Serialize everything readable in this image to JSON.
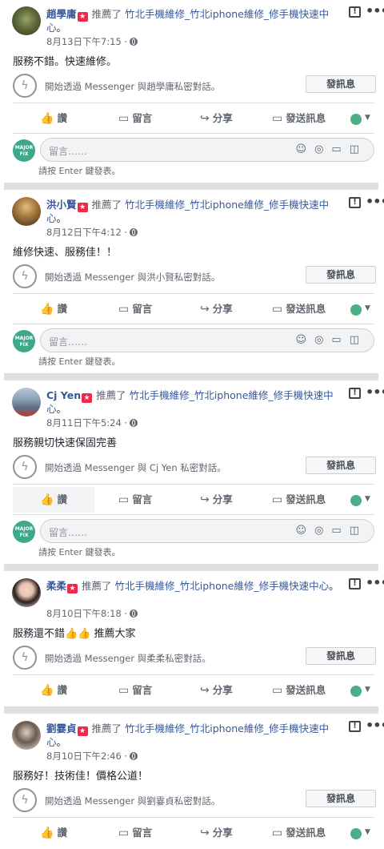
{
  "common": {
    "recommended": "推薦了",
    "page_name": "竹北手機維修_竹北iphone維修_修手機快速中心",
    "page_suffix": "。",
    "messenger_btn": "發訊息",
    "like": "讚",
    "comment": "留言",
    "share": "分享",
    "send": "發送訊息",
    "comment_placeholder": "留言……",
    "enter_hint": "請按 Enter 鍵發表。",
    "commenter_avatar": "MAJOR FIX",
    "flag_icon": "flag-icon",
    "more_icon": "more-icon"
  },
  "posts": [
    {
      "name": "趙學庸",
      "time": "8月13日下午7:15 ·",
      "body": "服務不錯。快速維修。",
      "messenger": "開始透過 Messenger 與趙學庸私密對話。"
    },
    {
      "name": "洪小賢",
      "time": "8月12日下午4:12 ·",
      "body": "維修快速、服務佳！！",
      "messenger": "開始透過 Messenger 與洪小賢私密對話。"
    },
    {
      "name": "Cj Yen",
      "time": "8月11日下午5:24 ·",
      "body": "服務親切快速保固完善",
      "messenger": "開始透過 Messenger 與 Cj Yen 私密對話。"
    },
    {
      "name": "柔柔",
      "time": "8月10日下午8:18 ·",
      "body": "服務還不錯👍👍 推薦大家",
      "messenger": "開始透過 Messenger 與柔柔私密對話。"
    },
    {
      "name": "劉霎貞",
      "time": "8月10日下午2:46 ·",
      "body": "服務好！技術佳！價格公道！",
      "messenger": "開始透過 Messenger 與劉霎貞私密對話。"
    }
  ]
}
